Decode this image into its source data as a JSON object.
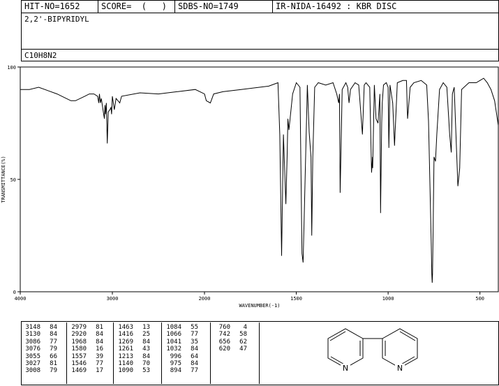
{
  "header": {
    "hit": "HIT-NO=1652",
    "score": "SCORE=  (   )",
    "sdbs": "SDBS-NO=1749",
    "ir": "IR-NIDA-16492 : KBR DISC"
  },
  "compound": {
    "name": "2,2'-BIPYRIDYL",
    "formula": "C10H8N2"
  },
  "chart_data": {
    "type": "line",
    "xlabel": "WAVENUMBER(-1)",
    "ylabel": "TRANSMITTANCE(%)",
    "xlim": [
      4000,
      400
    ],
    "ylim": [
      0,
      100
    ],
    "x_ticks": [
      "4000",
      "3000",
      "2000",
      "1500",
      "1000",
      "500"
    ],
    "y_ticks": [
      "100",
      "50",
      "0"
    ],
    "series": [
      {
        "x": [
          4000,
          3900,
          3800,
          3700,
          3600,
          3500,
          3450,
          3400,
          3300,
          3250,
          3200,
          3160,
          3148,
          3140,
          3130,
          3120,
          3095,
          3086,
          3080,
          3076,
          3065,
          3055,
          3045,
          3027,
          3015,
          3008,
          3000,
          2979,
          2960,
          2920,
          2900,
          2700,
          2500,
          2300,
          2100,
          2000,
          1990,
          1968,
          1950,
          1900,
          1800,
          1700,
          1650,
          1600,
          1590,
          1580,
          1570,
          1557,
          1550,
          1546,
          1540,
          1520,
          1500,
          1480,
          1469,
          1463,
          1455,
          1440,
          1430,
          1420,
          1416,
          1410,
          1400,
          1380,
          1340,
          1300,
          1280,
          1269,
          1265,
          1261,
          1250,
          1230,
          1220,
          1213,
          1205,
          1180,
          1160,
          1140,
          1130,
          1120,
          1100,
          1090,
          1085,
          1084,
          1075,
          1066,
          1055,
          1045,
          1041,
          1035,
          1032,
          1025,
          1010,
          1000,
          996,
          990,
          975,
          965,
          950,
          920,
          900,
          894,
          880,
          860,
          820,
          790,
          780,
          770,
          765,
          762,
          760,
          758,
          756,
          750,
          742,
          735,
          720,
          700,
          680,
          665,
          656,
          650,
          640,
          620,
          610,
          600,
          560,
          520,
          500,
          480,
          460,
          440,
          420,
          400
        ],
        "y": [
          90,
          90,
          91,
          89.5,
          88,
          86,
          85,
          85,
          87,
          88,
          88,
          87,
          84,
          88,
          84,
          86,
          79,
          77,
          83,
          79,
          84,
          66,
          80,
          81,
          82,
          79,
          87,
          81,
          86,
          84,
          87,
          88.5,
          88,
          89,
          90,
          88,
          85,
          84,
          88,
          89,
          90,
          91,
          91.5,
          93,
          70,
          16,
          70,
          39,
          60,
          77,
          72,
          88,
          93,
          91,
          17,
          13,
          40,
          92,
          71,
          60,
          25,
          60,
          91,
          93,
          92,
          93,
          88,
          84,
          88,
          44,
          90,
          93,
          91,
          84,
          90,
          93,
          92,
          70,
          92,
          93,
          91,
          53,
          60,
          55,
          92,
          77,
          75,
          88,
          35,
          75,
          84,
          92,
          93,
          91,
          64,
          92,
          84,
          65,
          93,
          94,
          94,
          77,
          91,
          93,
          94,
          92,
          76,
          40,
          20,
          8,
          4,
          8,
          20,
          60,
          58,
          70,
          90,
          93,
          91,
          70,
          62,
          88,
          91,
          47,
          55,
          90,
          93,
          93,
          94,
          95,
          93,
          90,
          85,
          74
        ]
      }
    ]
  },
  "peaks": [
    [
      [
        "3148",
        "84"
      ],
      [
        "3130",
        "84"
      ],
      [
        "3086",
        "77"
      ],
      [
        "3076",
        "79"
      ],
      [
        "3055",
        "66"
      ],
      [
        "3027",
        "81"
      ],
      [
        "3008",
        "79"
      ]
    ],
    [
      [
        "2979",
        "81"
      ],
      [
        "2920",
        "84"
      ],
      [
        "1968",
        "84"
      ],
      [
        "1580",
        "16"
      ],
      [
        "1557",
        "39"
      ],
      [
        "1546",
        "77"
      ],
      [
        "1469",
        "17"
      ]
    ],
    [
      [
        "1463",
        "13"
      ],
      [
        "1416",
        "25"
      ],
      [
        "1269",
        "84"
      ],
      [
        "1261",
        "43"
      ],
      [
        "1213",
        "84"
      ],
      [
        "1140",
        "70"
      ],
      [
        "1090",
        "53"
      ]
    ],
    [
      [
        "1084",
        "55"
      ],
      [
        "1066",
        "77"
      ],
      [
        "1041",
        "35"
      ],
      [
        "1032",
        "84"
      ],
      [
        "996",
        "64"
      ],
      [
        "975",
        "84"
      ],
      [
        "894",
        "77"
      ]
    ],
    [
      [
        "760",
        "4"
      ],
      [
        "742",
        "58"
      ],
      [
        "656",
        "62"
      ],
      [
        "620",
        "47"
      ]
    ]
  ],
  "structure": {
    "atom1": "N",
    "atom2": "N"
  }
}
